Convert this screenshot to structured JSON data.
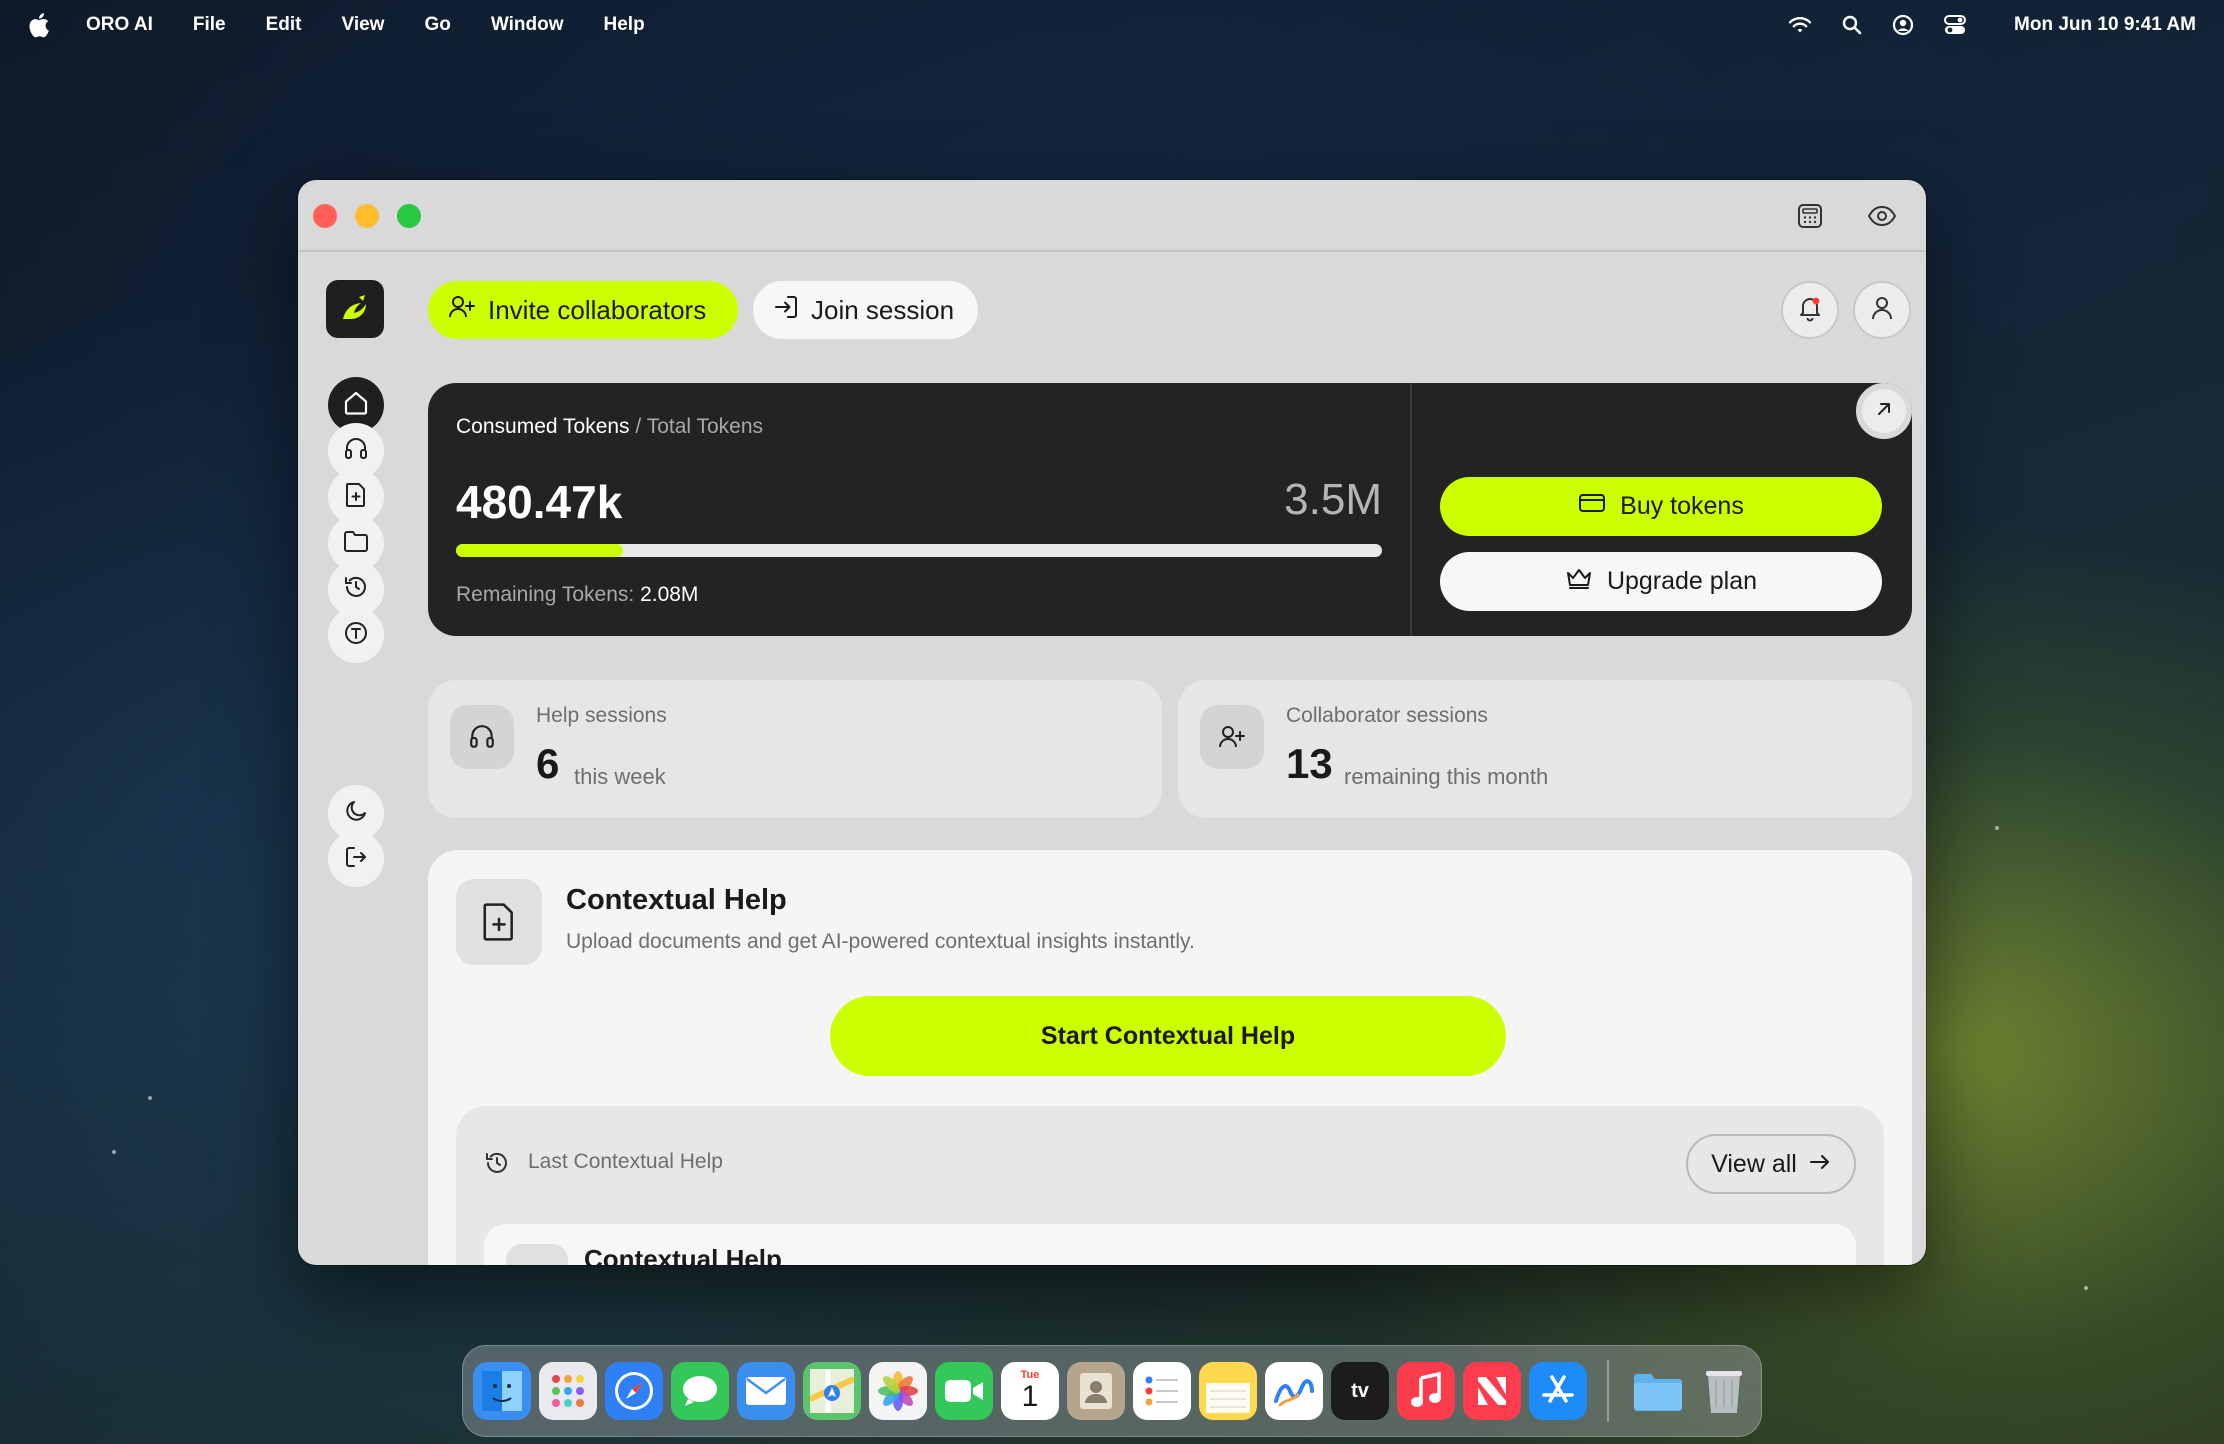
{
  "menubar": {
    "app_name": "ORO AI",
    "items": [
      "File",
      "Edit",
      "View",
      "Go",
      "Window",
      "Help"
    ],
    "clock": "Mon Jun 10  9:41 AM",
    "status_icons": [
      "wifi-icon",
      "search-icon",
      "user-circle-icon",
      "control-center-icon"
    ]
  },
  "header": {
    "invite_label": "Invite collaborators",
    "join_label": "Join session"
  },
  "tokens": {
    "consumed_label": "Consumed Tokens",
    "total_label": "Total Tokens",
    "separator": " / ",
    "consumed_value": "480.47k",
    "total_value": "3.5M",
    "progress_fraction": 0.18,
    "remaining_label": "Remaining Tokens:",
    "remaining_value": "2.08M",
    "buy_label": "Buy tokens",
    "upgrade_label": "Upgrade plan"
  },
  "stats": {
    "help": {
      "title": "Help sessions",
      "value": "6",
      "suffix": "this week"
    },
    "collab": {
      "title": "Collaborator sessions",
      "value": "13",
      "suffix": "remaining this month"
    }
  },
  "contextual": {
    "title": "Contextual Help",
    "description": "Upload documents and get AI-powered contextual insights instantly.",
    "start_label": "Start Contextual Help",
    "last_label": "Last Contextual Help",
    "view_all_label": "View all",
    "items": [
      {
        "title": "Contextual Help"
      }
    ]
  },
  "dock": {
    "apps": [
      {
        "name": "Finder",
        "color": "#3a8ef0"
      },
      {
        "name": "Launchpad",
        "color": "#e9e9ee"
      },
      {
        "name": "Safari",
        "color": "#2f7ff5"
      },
      {
        "name": "Messages",
        "color": "#34c759"
      },
      {
        "name": "Mail",
        "color": "#3a8ef0"
      },
      {
        "name": "Maps",
        "color": "#5bc36b"
      },
      {
        "name": "Photos",
        "color": "#f4f4f4"
      },
      {
        "name": "FaceTime",
        "color": "#34c759"
      },
      {
        "name": "Calendar",
        "color": "#ffffff"
      },
      {
        "name": "Contacts",
        "color": "#b5a58c"
      },
      {
        "name": "Reminders",
        "color": "#ffffff"
      },
      {
        "name": "Notes",
        "color": "#ffd84d"
      },
      {
        "name": "Freeform",
        "color": "#ffffff"
      },
      {
        "name": "TV",
        "color": "#1c1c1e"
      },
      {
        "name": "Music",
        "color": "#fa3c4c"
      },
      {
        "name": "News",
        "color": "#ff3b4e"
      },
      {
        "name": "App Store",
        "color": "#1d8cf8"
      }
    ],
    "calendar_month": "Tue",
    "calendar_day": "1",
    "tv_label": "tv",
    "trailing": [
      {
        "name": "Downloads",
        "color": "#5fb3f0"
      },
      {
        "name": "Trash",
        "color": "#c9ccd1"
      }
    ]
  },
  "colors": {
    "accent": "#ccff00",
    "dark": "#232323"
  }
}
